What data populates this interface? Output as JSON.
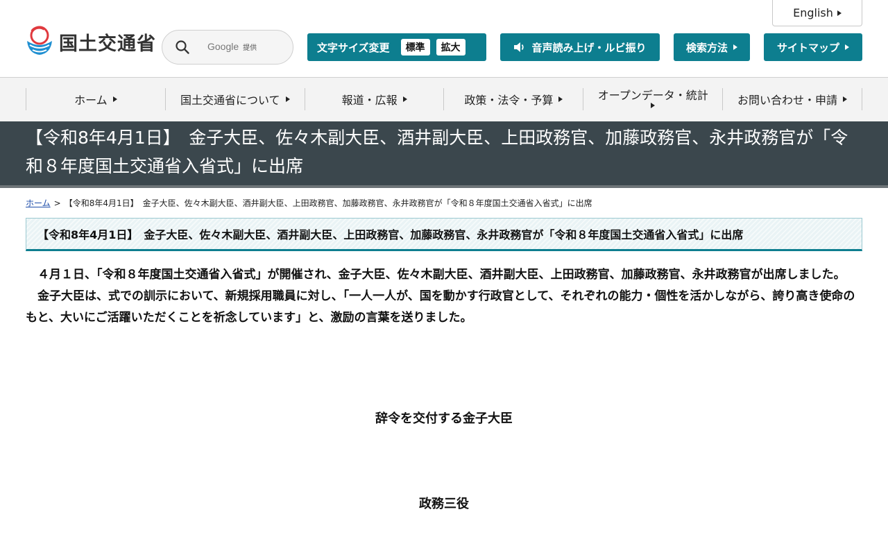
{
  "header": {
    "site_name": "国土交通省",
    "language_link": "English",
    "search": {
      "brand": "Google",
      "provided": "提供"
    },
    "buttons": {
      "font_size_label": "文字サイズ変更",
      "font_standard": "標準",
      "font_large": "拡大",
      "voice": "音声読み上げ・ルビ振り",
      "search_method": "検索方法",
      "sitemap": "サイトマップ"
    }
  },
  "nav": {
    "items": [
      {
        "label": "ホーム"
      },
      {
        "label": "国土交通省について"
      },
      {
        "label": "報道・広報"
      },
      {
        "label": "政策・法令・予算"
      },
      {
        "label": "オープンデータ・統計"
      },
      {
        "label": "お問い合わせ・申請"
      }
    ]
  },
  "page": {
    "title": "【令和8年4月1日】　金子大臣、佐々木副大臣、酒井副大臣、上田政務官、加藤政務官、永井政務官が「令和８年度国土交通省入省式」に出席"
  },
  "breadcrumb": {
    "home": "ホーム",
    "separator": ">",
    "current": "【令和8年4月1日】　金子大臣、佐々木副大臣、酒井副大臣、上田政務官、加藤政務官、永井政務官が「令和８年度国土交通省入省式」に出席"
  },
  "article": {
    "heading": "【令和8年4月1日】　金子大臣、佐々木副大臣、酒井副大臣、上田政務官、加藤政務官、永井政務官が「令和８年度国土交通省入省式」に出席",
    "paragraphs": [
      "４月１日、「令和８年度国土交通省入省式」が開催され、金子大臣、佐々木副大臣、酒井副大臣、上田政務官、加藤政務官、永井政務官が出席しました。",
      "金子大臣は、式での訓示において、新規採用職員に対し、「一人一人が、国を動かす行政官として、それぞれの能力・個性を活かしながら、誇り高き使命のもと、大いにご活躍いただくことを祈念しています」と、激励の言葉を送りました。"
    ],
    "captions": [
      "辞令を交付する金子大臣",
      "政務三役"
    ]
  },
  "colors": {
    "accent": "#0d7e8f",
    "title_band": "#3b474d",
    "nav_bg": "#f3f3f3",
    "link": "#1a4aa8"
  }
}
